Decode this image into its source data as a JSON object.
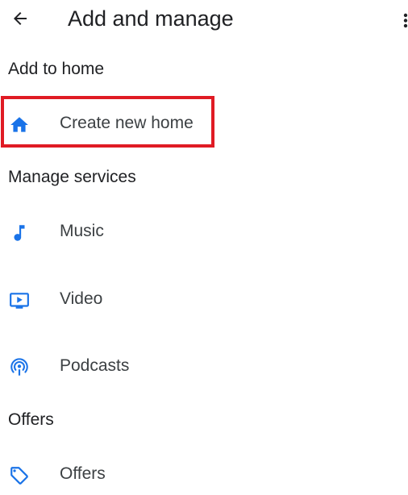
{
  "header": {
    "title": "Add and manage",
    "back_icon": "arrow-back-icon",
    "more_icon": "more-vert-icon"
  },
  "sections": [
    {
      "title": "Add to home",
      "items": [
        {
          "label": "Create new home",
          "icon": "home-icon"
        }
      ]
    },
    {
      "title": "Manage services",
      "items": [
        {
          "label": "Music",
          "icon": "music-note-icon"
        },
        {
          "label": "Video",
          "icon": "video-icon"
        },
        {
          "label": "Podcasts",
          "icon": "podcasts-icon"
        }
      ]
    },
    {
      "title": "Offers",
      "items": [
        {
          "label": "Offers",
          "icon": "tag-icon"
        }
      ]
    }
  ],
  "colors": {
    "icon_blue": "#1a73e8",
    "highlight_red": "#e01b24",
    "text_primary": "#202124",
    "text_secondary": "#3c4043"
  }
}
